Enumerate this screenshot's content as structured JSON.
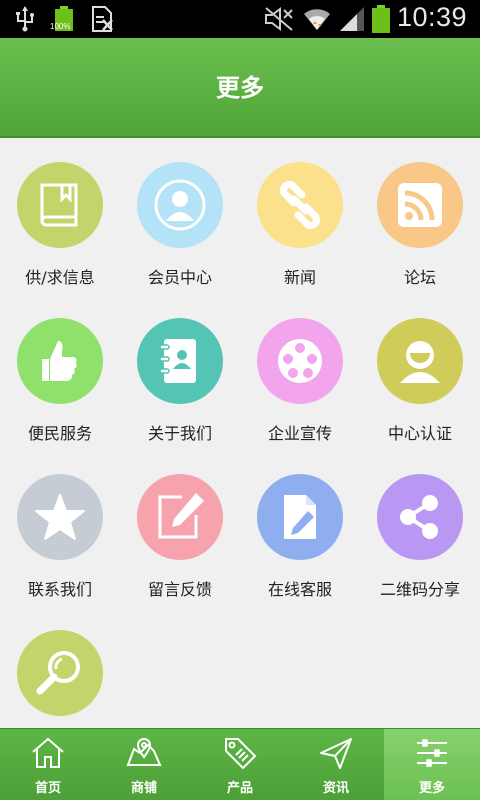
{
  "status_bar": {
    "time": "10:39",
    "battery_small_pct": "100%",
    "icons": [
      "usb-icon",
      "battery-full-icon",
      "document-icon",
      "mute-icon",
      "wifi-icon",
      "signal-icon",
      "battery-icon"
    ]
  },
  "header": {
    "title": "更多"
  },
  "grid": {
    "items": [
      {
        "label": "供/求信息",
        "icon": "book-icon",
        "color": "#c2d46a"
      },
      {
        "label": "会员中心",
        "icon": "user-icon",
        "color": "#b4e2f6"
      },
      {
        "label": "新闻",
        "icon": "link-icon",
        "color": "#fbe18c"
      },
      {
        "label": "论坛",
        "icon": "rss-icon",
        "color": "#f9c787"
      },
      {
        "label": "便民服务",
        "icon": "thumbs-up-icon",
        "color": "#90e06c"
      },
      {
        "label": "关于我们",
        "icon": "contact-book-icon",
        "color": "#54c4b4"
      },
      {
        "label": "企业宣传",
        "icon": "film-reel-icon",
        "color": "#f2a4ec"
      },
      {
        "label": "中心认证",
        "icon": "avatar-icon",
        "color": "#d0cc5a"
      },
      {
        "label": "联系我们",
        "icon": "star-icon",
        "color": "#c6ccd4"
      },
      {
        "label": "留言反馈",
        "icon": "edit-icon",
        "color": "#f6a3ad"
      },
      {
        "label": "在线客服",
        "icon": "document-edit-icon",
        "color": "#8eaef0"
      },
      {
        "label": "二维码分享",
        "icon": "share-icon",
        "color": "#b898f2"
      },
      {
        "label": "",
        "icon": "magnifier-icon",
        "color": "#c2d46a"
      }
    ]
  },
  "bottom_nav": {
    "items": [
      {
        "label": "首页",
        "icon": "home-icon"
      },
      {
        "label": "商铺",
        "icon": "map-icon"
      },
      {
        "label": "产品",
        "icon": "sale-tag-icon"
      },
      {
        "label": "资讯",
        "icon": "send-icon"
      },
      {
        "label": "更多",
        "icon": "settings-sliders-icon",
        "active": true
      }
    ]
  }
}
